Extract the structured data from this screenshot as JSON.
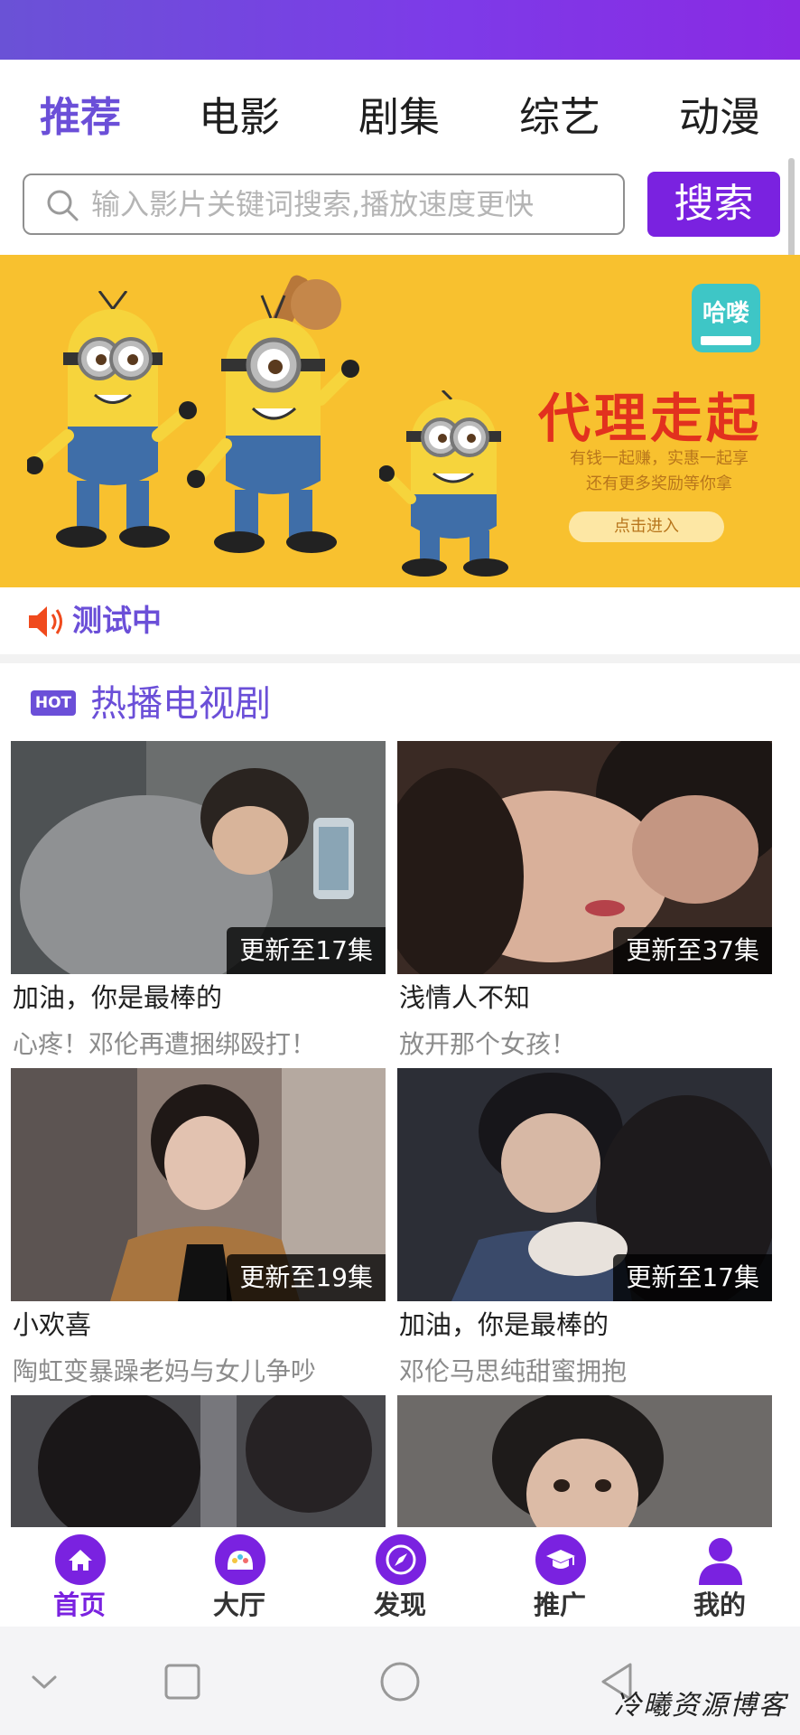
{
  "tabs": [
    {
      "label": "推荐",
      "active": true
    },
    {
      "label": "电影",
      "active": false
    },
    {
      "label": "剧集",
      "active": false
    },
    {
      "label": "综艺",
      "active": false
    },
    {
      "label": "动漫",
      "active": false
    }
  ],
  "search": {
    "placeholder": "输入影片关键词搜索,播放速度更快",
    "button_label": "搜索"
  },
  "banner": {
    "logo_text": "哈喽",
    "title": "代理走起",
    "subtitle_line1": "有钱一起赚，实惠一起享",
    "subtitle_line2": "还有更多奖励等你拿",
    "cta_label": "点击进入"
  },
  "notice": {
    "text": "测试中",
    "icon": "speaker-icon"
  },
  "section": {
    "badge": "HOT",
    "title": "热播电视剧"
  },
  "shows": [
    {
      "title": "加油，你是最棒的",
      "subtitle": "心疼！邓伦再遭捆绑殴打！",
      "update": "更新至17集"
    },
    {
      "title": "浅情人不知",
      "subtitle": "放开那个女孩！",
      "update": "更新至37集"
    },
    {
      "title": "小欢喜",
      "subtitle": "陶虹变暴躁老妈与女儿争吵",
      "update": "更新至19集"
    },
    {
      "title": "加油，你是最棒的",
      "subtitle": "邓伦马思纯甜蜜拥抱",
      "update": "更新至17集"
    }
  ],
  "bottom_nav": [
    {
      "label": "首页",
      "icon": "home-icon",
      "active": true
    },
    {
      "label": "大厅",
      "icon": "hall-icon",
      "active": false
    },
    {
      "label": "发现",
      "icon": "compass-icon",
      "active": false
    },
    {
      "label": "推广",
      "icon": "graduation-cap-icon",
      "active": false
    },
    {
      "label": "我的",
      "icon": "user-icon",
      "active": false
    }
  ],
  "watermark": "冷曦资源博客",
  "colors": {
    "accent": "#7a22e0",
    "tab_active": "#6b4fd8",
    "banner_bg": "#f8c12f"
  }
}
